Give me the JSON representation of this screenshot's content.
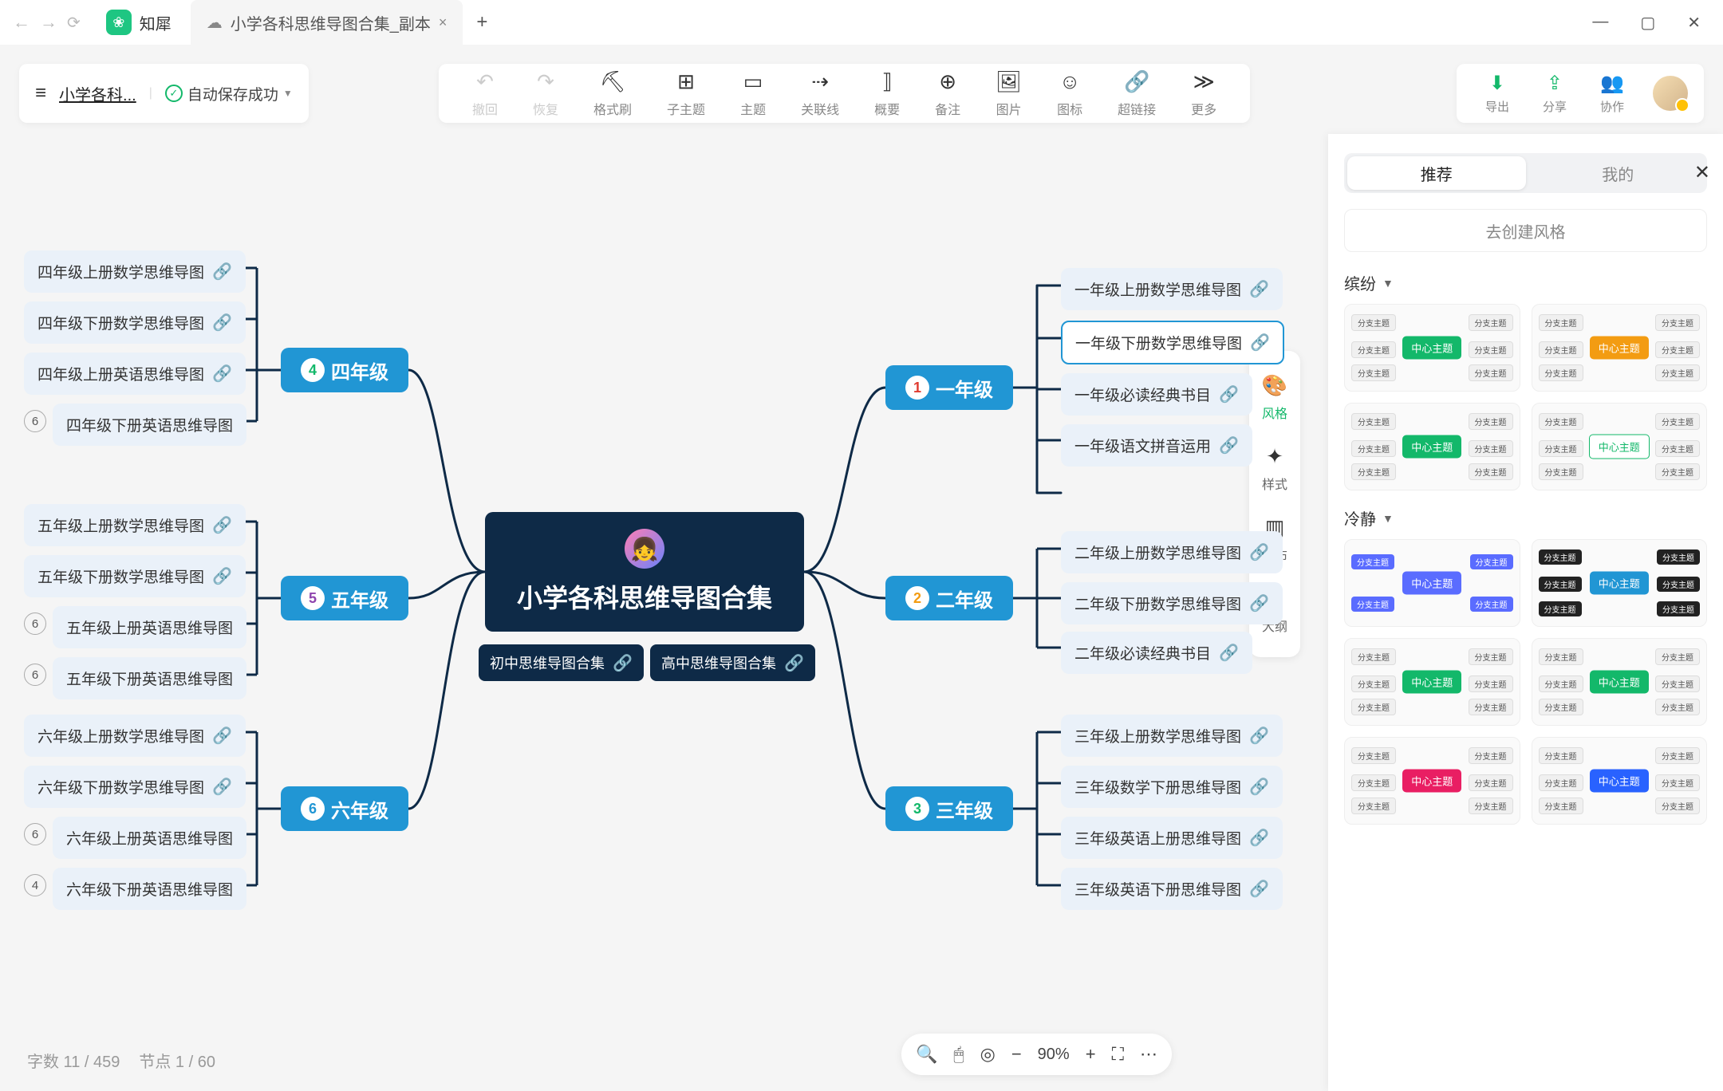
{
  "titlebar": {
    "app_tab": "知犀",
    "doc_tab": "小学各科思维导图合集_副本"
  },
  "docbar": {
    "menu": "≡",
    "title": "小学各科...",
    "save_state": "自动保存成功"
  },
  "toolbar": {
    "undo": "撤回",
    "redo": "恢复",
    "format": "格式刷",
    "subtopic": "子主题",
    "topic": "主题",
    "relation": "关联线",
    "summary": "概要",
    "note": "备注",
    "image": "图片",
    "icon": "图标",
    "hyperlink": "超链接",
    "more": "更多"
  },
  "rightbar": {
    "export": "导出",
    "share": "分享",
    "collab": "协作"
  },
  "mindmap": {
    "center": "小学各科思维导图合集",
    "sub_left": "初中思维导图合集",
    "sub_right": "高中思维导图合集",
    "grades": {
      "g1": {
        "num": "1",
        "label": "一年级"
      },
      "g2": {
        "num": "2",
        "label": "二年级"
      },
      "g3": {
        "num": "3",
        "label": "三年级"
      },
      "g4": {
        "num": "4",
        "label": "四年级"
      },
      "g5": {
        "num": "5",
        "label": "五年级"
      },
      "g6": {
        "num": "6",
        "label": "六年级"
      }
    },
    "leaves": {
      "g1_1": "一年级上册数学思维导图",
      "g1_2": "一年级下册数学思维导图",
      "g1_3": "一年级必读经典书目",
      "g1_4": "一年级语文拼音运用",
      "g2_1": "二年级上册数学思维导图",
      "g2_2": "二年级下册数学思维导图",
      "g2_3": "二年级必读经典书目",
      "g3_1": "三年级上册数学思维导图",
      "g3_2": "三年级数学下册思维导图",
      "g3_3": "三年级英语上册思维导图",
      "g3_4": "三年级英语下册思维导图",
      "g4_1": "四年级上册数学思维导图",
      "g4_2": "四年级下册数学思维导图",
      "g4_3": "四年级上册英语思维导图",
      "g4_4": "四年级下册英语思维导图",
      "g5_1": "五年级上册数学思维导图",
      "g5_2": "五年级下册数学思维导图",
      "g5_3": "五年级上册英语思维导图",
      "g5_4": "五年级下册英语思维导图",
      "g6_1": "六年级上册数学思维导图",
      "g6_2": "六年级下册数学思维导图",
      "g6_3": "六年级上册英语思维导图",
      "g6_4": "六年级下册英语思维导图"
    },
    "counts": {
      "g4_4": "6",
      "g5_3": "6",
      "g5_4": "6",
      "g6_3": "6",
      "g6_4": "4"
    }
  },
  "side_tools": {
    "style": "风格",
    "format": "样式",
    "canvas": "画布",
    "outline": "大纲"
  },
  "panel": {
    "tab_rec": "推荐",
    "tab_mine": "我的",
    "create": "去创建风格",
    "section1": "缤纷",
    "section2": "冷静",
    "thumb_center": "中心主题",
    "thumb_branch": "分支主题"
  },
  "status": {
    "words": "字数 11 / 459",
    "nodes": "节点 1 / 60"
  },
  "zoom": {
    "value": "90%"
  }
}
